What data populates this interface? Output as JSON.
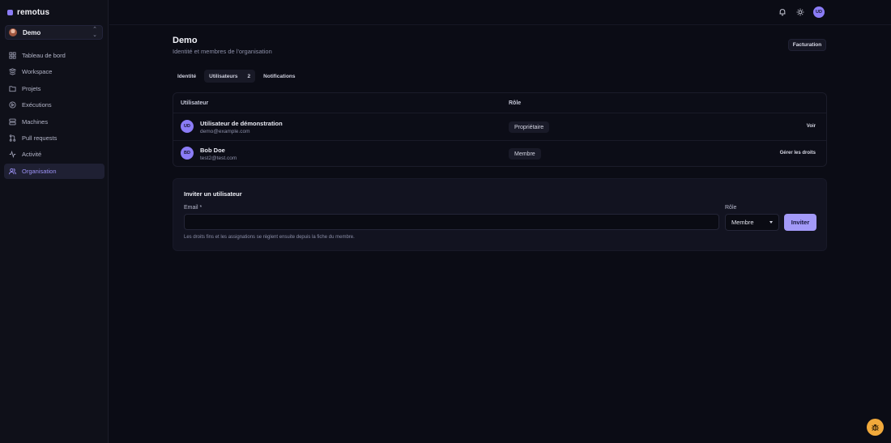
{
  "app": {
    "brand": "remotus"
  },
  "sidebar": {
    "org_switcher": {
      "name": "Demo"
    },
    "items": [
      {
        "label": "Tableau de bord",
        "icon": "dashboard-icon",
        "active": false
      },
      {
        "label": "Workspace",
        "icon": "workspace-icon",
        "active": false
      },
      {
        "label": "Projets",
        "icon": "folder-icon",
        "active": false
      },
      {
        "label": "Exécutions",
        "icon": "play-circle-icon",
        "active": false
      },
      {
        "label": "Machines",
        "icon": "server-icon",
        "active": false
      },
      {
        "label": "Pull requests",
        "icon": "git-pull-request-icon",
        "active": false
      },
      {
        "label": "Activité",
        "icon": "activity-icon",
        "active": false
      },
      {
        "label": "Organisation",
        "icon": "users-icon",
        "active": true
      }
    ]
  },
  "topbar": {
    "user_initials": "UD",
    "icons": [
      "bell-icon",
      "sun-icon"
    ]
  },
  "page": {
    "title": "Demo",
    "subtitle": "Identité et membres de l'organisation",
    "billing_label": "Facturation"
  },
  "tabs": [
    {
      "label": "Identité",
      "active": false
    },
    {
      "label": "Utilisateurs",
      "count": "2",
      "active": true
    },
    {
      "label": "Notifications",
      "active": false
    }
  ],
  "users_table": {
    "columns": {
      "user": "Utilisateur",
      "role": "Rôle"
    },
    "rows": [
      {
        "initials": "UD",
        "name": "Utilisateur de démonstration",
        "email": "demo@example.com",
        "role": "Propriétaire",
        "action": "Voir"
      },
      {
        "initials": "BD",
        "name": "Bob Doe",
        "email": "test2@test.com",
        "role": "Membre",
        "action": "Gérer les droits"
      }
    ]
  },
  "invite": {
    "title": "Inviter un utilisateur",
    "email_label": "Email *",
    "email_value": "",
    "email_placeholder": "",
    "role_label": "Rôle",
    "role_selected": "Membre",
    "submit_label": "Inviter",
    "note": "Les droits fins et les assignations se règlent ensuite depuis la fiche du membre."
  },
  "colors": {
    "accent": "#8b7cf6",
    "background": "#0b0c15",
    "fab": "#f1a93b"
  }
}
